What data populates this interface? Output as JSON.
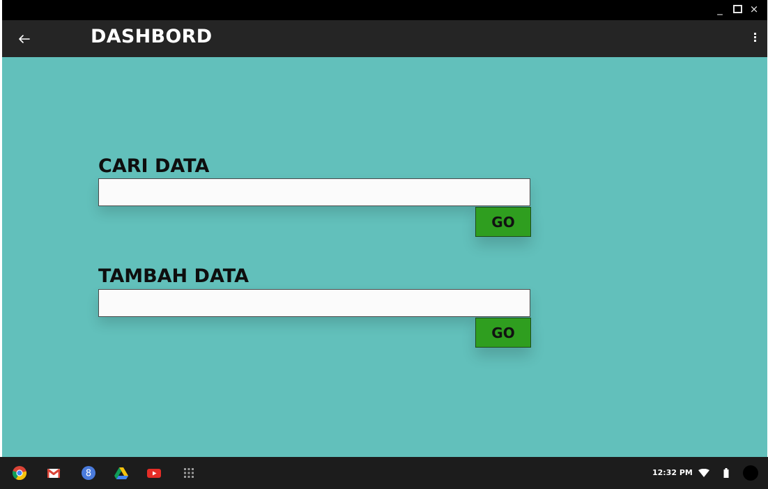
{
  "window": {
    "controls": [
      "minimize",
      "maximize",
      "close"
    ],
    "minimize_glyph": "_",
    "close_glyph": "×"
  },
  "appbar": {
    "title": "DASHBORD",
    "back_icon": "arrow-left-icon",
    "menu_icon": "more-vertical-icon"
  },
  "sections": [
    {
      "label": "CARI DATA",
      "input_value": "",
      "button_label": "GO"
    },
    {
      "label": "TAMBAH DATA",
      "input_value": "",
      "button_label": "GO"
    }
  ],
  "colors": {
    "background": "#62c0bb",
    "appbar": "#252525",
    "button": "#2f9e1f",
    "shelf": "#1c1c1c"
  },
  "taskbar": {
    "apps": [
      "chrome-icon",
      "gmail-icon",
      "google-plus-icon",
      "drive-icon",
      "youtube-icon",
      "app-launcher-icon"
    ],
    "time": "12:32 PM",
    "status_icons": [
      "wifi-icon",
      "battery-icon",
      "avatar"
    ]
  }
}
